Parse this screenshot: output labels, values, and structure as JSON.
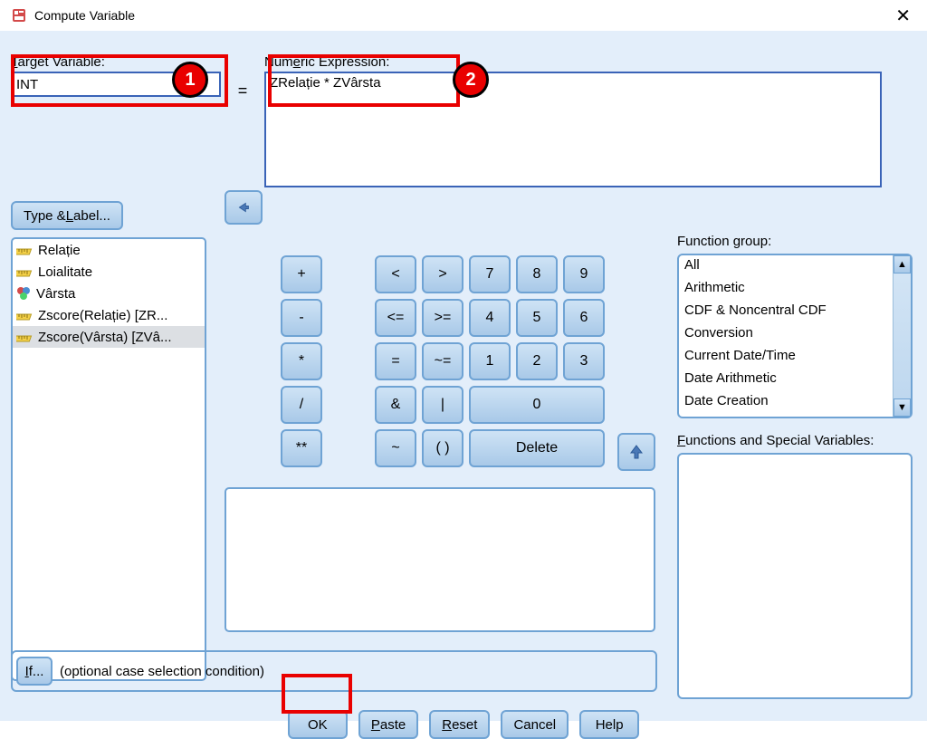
{
  "window": {
    "title": "Compute Variable"
  },
  "target_var": {
    "label_pre": "T",
    "label_mid": "arget Variable:",
    "value": "INT"
  },
  "equals": "=",
  "numexpr": {
    "label_pre": "Num",
    "label_u": "e",
    "label_post": "ric Expression:",
    "value": "ZRelație * ZVârsta"
  },
  "type_label_btn": {
    "pre": "Type & ",
    "u": "L",
    "post": "abel..."
  },
  "variables": [
    {
      "name": "Relație",
      "icon": "ruler",
      "selected": false
    },
    {
      "name": "Loialitate",
      "icon": "ruler",
      "selected": false
    },
    {
      "name": "Vârsta",
      "icon": "nominal",
      "selected": false
    },
    {
      "name": "Zscore(Relație) [ZR...",
      "icon": "ruler",
      "selected": false
    },
    {
      "name": "Zscore(Vârsta) [ZVâ...",
      "icon": "ruler",
      "selected": true
    }
  ],
  "keypad": {
    "r1": [
      "+",
      "<",
      ">",
      "7",
      "8",
      "9"
    ],
    "r2": [
      "-",
      "<=",
      ">=",
      "4",
      "5",
      "6"
    ],
    "r3": [
      "*",
      "=",
      "~=",
      "1",
      "2",
      "3"
    ],
    "r4": [
      "/",
      "&",
      "|",
      "0"
    ],
    "r5": [
      "**",
      "~",
      "( )",
      "Delete"
    ]
  },
  "fn_group": {
    "label_pre": "Function ",
    "label_u": "g",
    "label_post": "roup:",
    "items": [
      "All",
      "Arithmetic",
      "CDF & Noncentral CDF",
      "Conversion",
      "Current Date/Time",
      "Date Arithmetic",
      "Date Creation"
    ]
  },
  "fn_spec": {
    "label_u": "F",
    "label_post": "unctions and Special Variables:"
  },
  "if_row": {
    "btn_u": "I",
    "btn_post": "f...",
    "text": "(optional case selection condition)"
  },
  "buttons": {
    "ok": "OK",
    "paste_u": "P",
    "paste_post": "aste",
    "reset_u": "R",
    "reset_post": "eset",
    "cancel": "Cancel",
    "help": "Help"
  },
  "annot": {
    "b1": "1",
    "b2": "2"
  }
}
